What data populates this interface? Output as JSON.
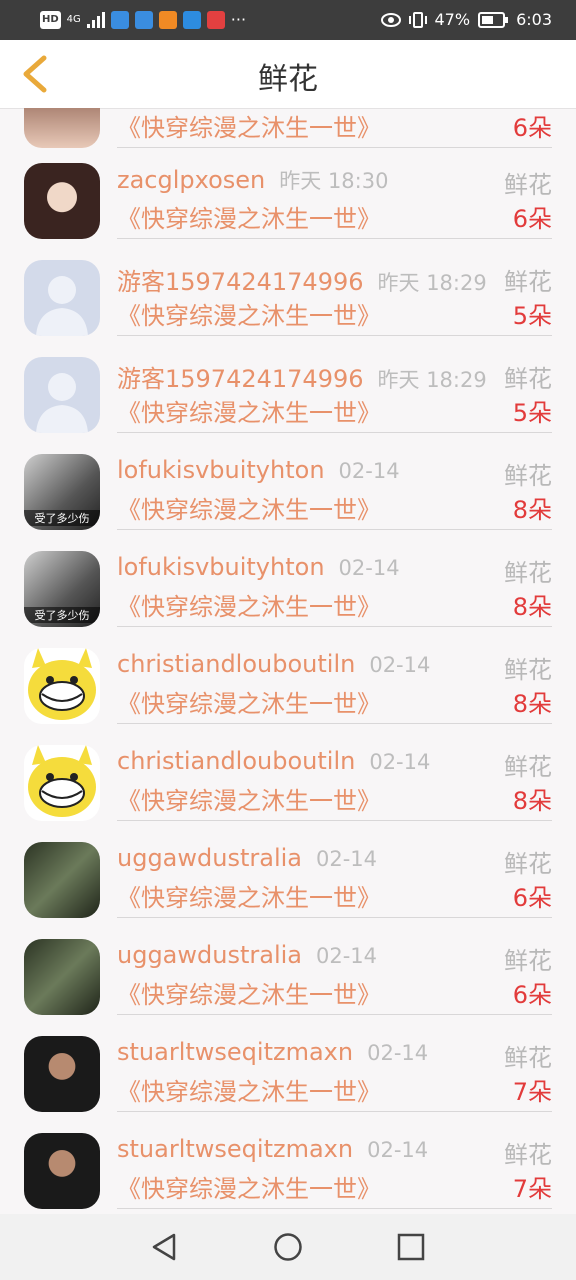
{
  "status_bar": {
    "left_badges": [
      "HD",
      "4G"
    ],
    "battery": "47%",
    "time": "6:03"
  },
  "header": {
    "title": "鲜花"
  },
  "partial_row": {
    "book": "《快穿综漫之沐生一世》",
    "count": "6朵"
  },
  "items": [
    {
      "name": "zacglpxosen",
      "time": "昨天 18:30",
      "label": "鲜花",
      "book": "《快穿综漫之沐生一世》",
      "count": "6朵",
      "avatar": "girl-photo"
    },
    {
      "name": "游客1597424174996",
      "time": "昨天 18:29",
      "label": "鲜花",
      "book": "《快穿综漫之沐生一世》",
      "count": "5朵",
      "avatar": "default-user"
    },
    {
      "name": "游客1597424174996",
      "time": "昨天 18:29",
      "label": "鲜花",
      "book": "《快穿综漫之沐生一世》",
      "count": "5朵",
      "avatar": "default-user"
    },
    {
      "name": "lofukisvbuityhton",
      "time": "02-14",
      "label": "鲜花",
      "book": "《快穿综漫之沐生一世》",
      "count": "8朵",
      "avatar": "bw-photo",
      "avatar_text": "受了多少伤"
    },
    {
      "name": "lofukisvbuityhton",
      "time": "02-14",
      "label": "鲜花",
      "book": "《快穿综漫之沐生一世》",
      "count": "8朵",
      "avatar": "bw-photo",
      "avatar_text": "受了多少伤"
    },
    {
      "name": "christiandlouboutiln",
      "time": "02-14",
      "label": "鲜花",
      "book": "《快穿综漫之沐生一世》",
      "count": "8朵",
      "avatar": "yellow-troll"
    },
    {
      "name": "christiandlouboutiln",
      "time": "02-14",
      "label": "鲜花",
      "book": "《快穿综漫之沐生一世》",
      "count": "8朵",
      "avatar": "yellow-troll"
    },
    {
      "name": "uggawdustralia",
      "time": "02-14",
      "label": "鲜花",
      "book": "《快穿综漫之沐生一世》",
      "count": "6朵",
      "avatar": "dark-photo"
    },
    {
      "name": "uggawdustralia",
      "time": "02-14",
      "label": "鲜花",
      "book": "《快穿综漫之沐生一世》",
      "count": "6朵",
      "avatar": "dark-photo"
    },
    {
      "name": "stuarltwseqitzmaxn",
      "time": "02-14",
      "label": "鲜花",
      "book": "《快穿综漫之沐生一世》",
      "count": "7朵",
      "avatar": "man-photo"
    },
    {
      "name": "stuarltwseqitzmaxn",
      "time": "02-14",
      "label": "鲜花",
      "book": "《快穿综漫之沐生一世》",
      "count": "7朵",
      "avatar": "man-photo"
    }
  ],
  "nav_bar": {
    "buttons": [
      "back-triangle-icon",
      "home-circle-icon",
      "recents-square-icon"
    ]
  }
}
